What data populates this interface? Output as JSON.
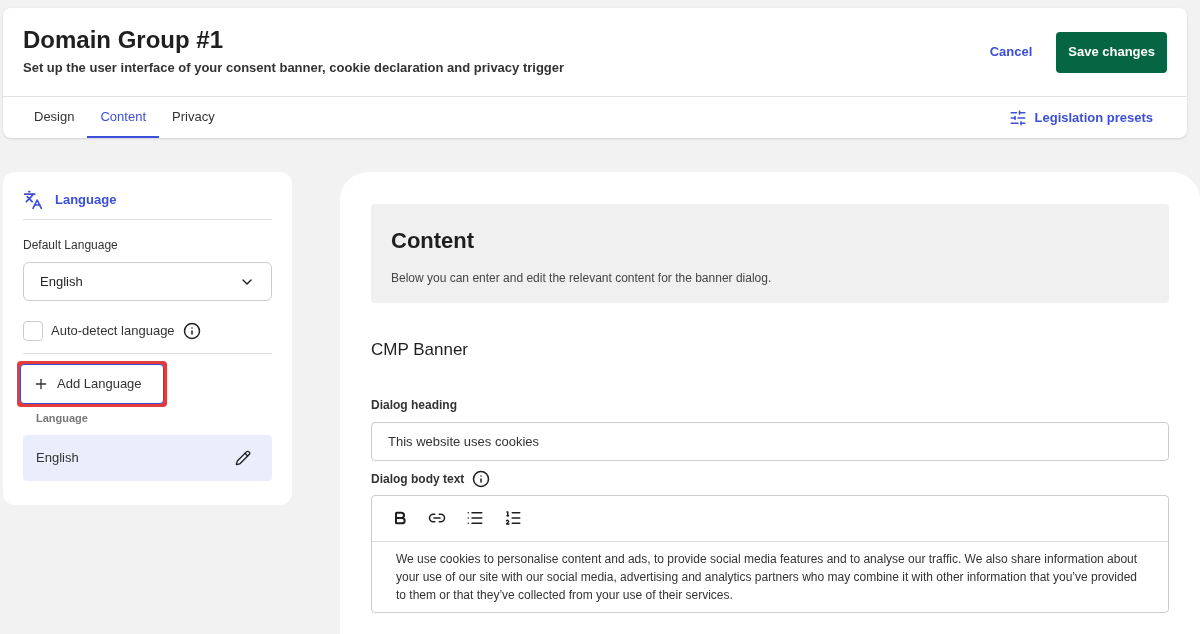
{
  "header": {
    "title": "Domain Group #1",
    "subtitle": "Set up the user interface of your consent banner, cookie declaration and privacy trigger",
    "cancel": "Cancel",
    "save": "Save changes"
  },
  "tabs": [
    {
      "label": "Design",
      "selected": false
    },
    {
      "label": "Content",
      "selected": true
    },
    {
      "label": "Privacy",
      "selected": false
    }
  ],
  "presets": "Legislation presets",
  "sidebar": {
    "section": "Language",
    "default_label": "Default Language",
    "default_value": "English",
    "auto_detect": {
      "label": "Auto-detect language",
      "checked": false
    },
    "add_button": {
      "label": "Add Language",
      "highlighted": true
    },
    "list_label": "Language",
    "languages": [
      {
        "name": "English",
        "selected": true
      }
    ]
  },
  "content": {
    "title": "Content",
    "description": "Below you can enter and edit the relevant content for the banner dialog.",
    "section": "CMP Banner",
    "heading_label": "Dialog heading",
    "heading_value": "This website uses cookies",
    "body_label": "Dialog body text",
    "body_value": "We use cookies to personalise content and ads, to provide social media features and to analyse our traffic. We also share information about your use of our site with our social media, advertising and analytics partners who may combine it with other information that you’ve provided to them or that they’ve collected from your use of their services."
  }
}
